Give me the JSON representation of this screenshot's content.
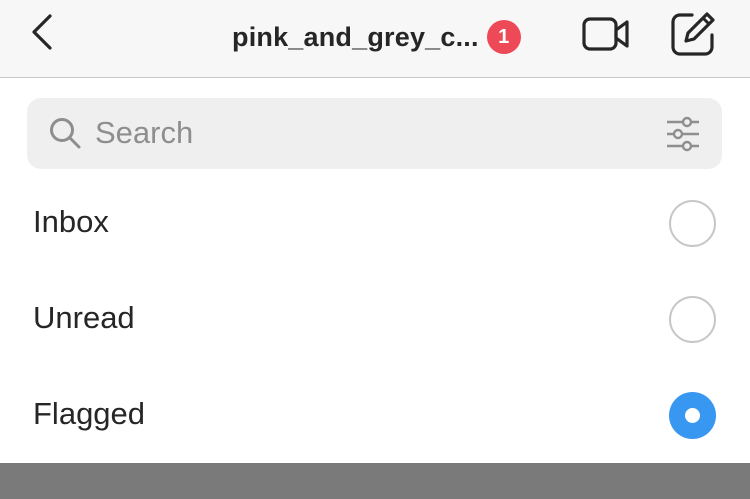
{
  "header": {
    "title": "pink_and_grey_c...",
    "badge_count": "1",
    "back_icon": "chevron-left-icon",
    "video_icon": "video-camera-icon",
    "compose_icon": "compose-icon"
  },
  "search": {
    "placeholder": "Search",
    "value": "",
    "search_icon": "magnifier-icon",
    "filter_icon": "sliders-icon"
  },
  "filters": {
    "items": [
      {
        "label": "Inbox",
        "selected": false
      },
      {
        "label": "Unread",
        "selected": false
      },
      {
        "label": "Flagged",
        "selected": true
      }
    ]
  },
  "colors": {
    "accent": "#3897f0",
    "badge": "#ed4956",
    "header_bg": "#f7f7f7",
    "search_bg": "#efefef",
    "text": "#262626",
    "overlay": "#7a7a7a"
  }
}
